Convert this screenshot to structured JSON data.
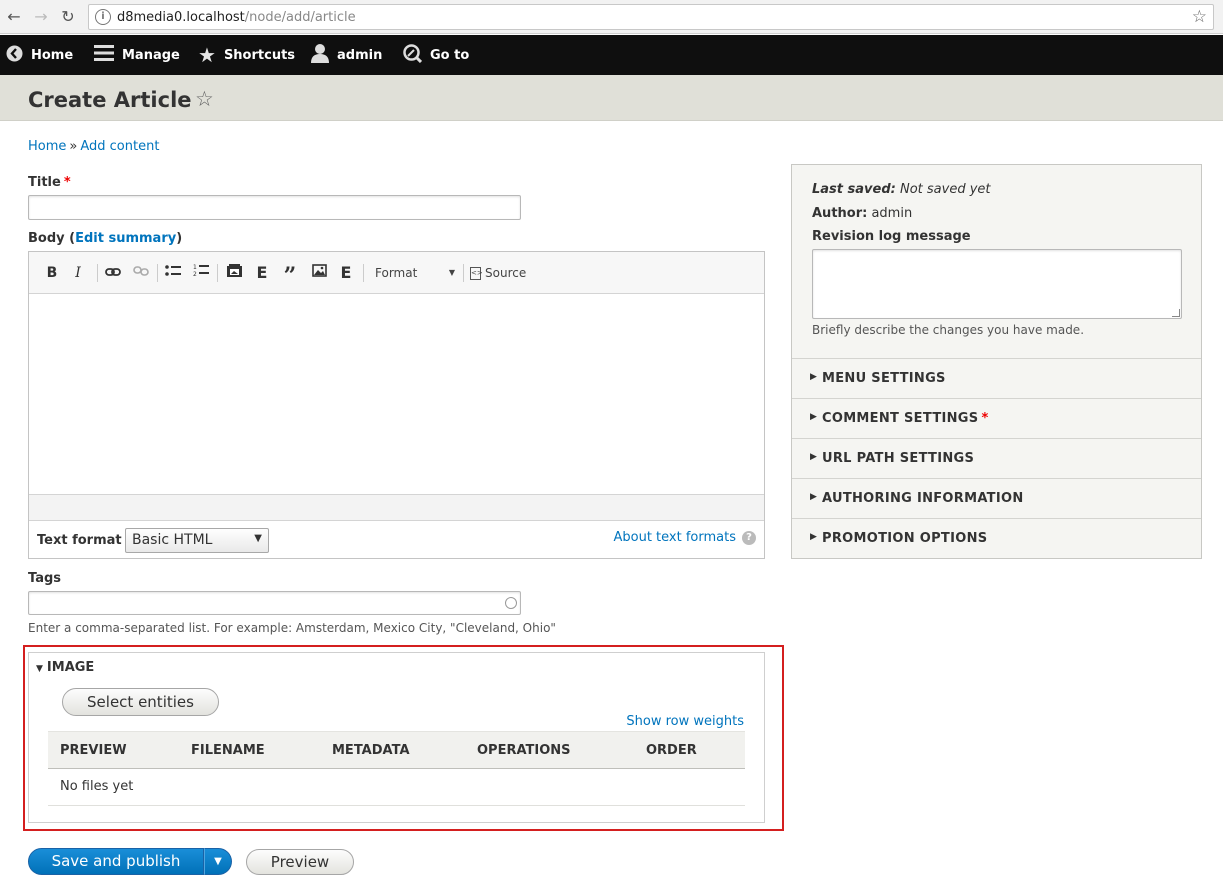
{
  "browser": {
    "url_host": "d8media0.localhost",
    "url_path": "/node/add/article"
  },
  "toolbar": {
    "items": [
      {
        "label": "Home",
        "icon": "back-circle-icon"
      },
      {
        "label": "Manage",
        "icon": "hamburger-icon"
      },
      {
        "label": "Shortcuts",
        "icon": "star-icon"
      },
      {
        "label": "admin",
        "icon": "user-icon"
      },
      {
        "label": "Go to",
        "icon": "search-icon"
      }
    ]
  },
  "header": {
    "title": "Create Article"
  },
  "breadcrumb": {
    "home": "Home",
    "sep": "»",
    "add_content": "Add content"
  },
  "form": {
    "title_label": "Title",
    "required_mark": "*",
    "body_label_prefix": "Body (",
    "body_label_link": "Edit summary",
    "body_label_suffix": ")",
    "editor": {
      "bold": "B",
      "italic": "I",
      "embed": "E",
      "quote": "”",
      "embed2": "E",
      "format": "Format",
      "source": "Source"
    },
    "text_format_label": "Text format",
    "text_format_value": "Basic HTML",
    "about_text_formats": "About text formats",
    "help_mark": "?",
    "tags_label": "Tags",
    "tags_desc": "Enter a comma-separated list. For example: Amsterdam, Mexico City, \"Cleveland, Ohio\""
  },
  "image": {
    "legend": "IMAGE",
    "select_button": "Select entities",
    "show_row_weights": "Show row weights",
    "columns": [
      "PREVIEW",
      "FILENAME",
      "METADATA",
      "OPERATIONS",
      "ORDER"
    ],
    "empty": "No files yet"
  },
  "sidebar": {
    "last_saved_label": "Last saved:",
    "last_saved_value": "Not saved yet",
    "author_label": "Author:",
    "author_value": "admin",
    "revision_label": "Revision log message",
    "revision_desc": "Briefly describe the changes you have made.",
    "sections": [
      {
        "title": "MENU SETTINGS",
        "required": false
      },
      {
        "title": "COMMENT SETTINGS",
        "required": true
      },
      {
        "title": "URL PATH SETTINGS",
        "required": false
      },
      {
        "title": "AUTHORING INFORMATION",
        "required": false
      },
      {
        "title": "PROMOTION OPTIONS",
        "required": false
      }
    ]
  },
  "actions": {
    "save_publish": "Save and publish",
    "preview": "Preview"
  },
  "colors": {
    "link": "#0074bd",
    "primary": "#0071b8",
    "toolbar_bg": "#0f0f0f",
    "highlight": "#d41f1f",
    "required": "#e00000"
  }
}
